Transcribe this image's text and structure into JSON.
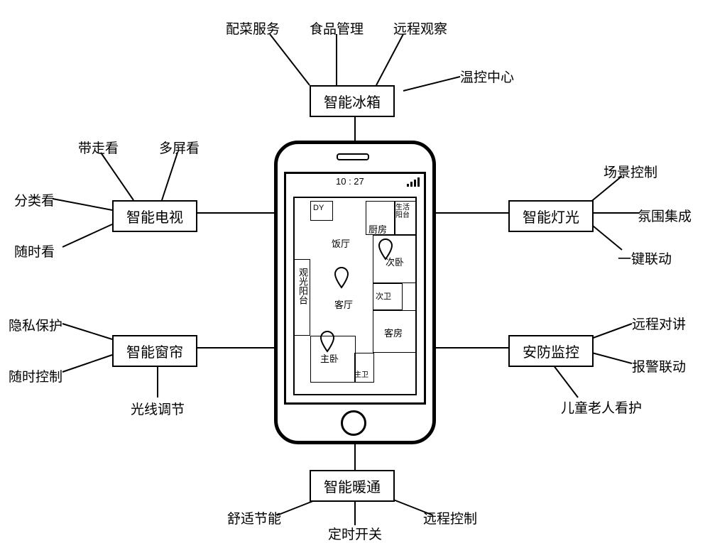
{
  "phone": {
    "time": "10 : 27",
    "floorplan": {
      "room_dy": "DY",
      "room_balcony_view": "观光阳台",
      "room_dining": "饭厅",
      "room_kitchen": "厨房",
      "room_life_balcony": "生活阳台",
      "room_second_bedroom": "次卧",
      "room_living": "客厅",
      "room_secondary_bath": "次卫",
      "room_master_bedroom": "主卧",
      "room_master_bath": "主卫",
      "room_guest": "客房"
    }
  },
  "nodes": {
    "fridge": {
      "label": "智能冰箱",
      "children": [
        "配菜服务",
        "食品管理",
        "远程观察",
        "温控中心"
      ]
    },
    "tv": {
      "label": "智能电视",
      "children": [
        "带走看",
        "多屏看",
        "分类看",
        "随时看"
      ]
    },
    "curtain": {
      "label": "智能窗帘",
      "children": [
        "隐私保护",
        "随时控制",
        "光线调节"
      ]
    },
    "light": {
      "label": "智能灯光",
      "children": [
        "场景控制",
        "氛围集成",
        "一键联动"
      ]
    },
    "security": {
      "label": "安防监控",
      "children": [
        "远程对讲",
        "报警联动",
        "儿童老人看护"
      ]
    },
    "hvac": {
      "label": "智能暖通",
      "children": [
        "舒适节能",
        "定时开关",
        "远程控制"
      ]
    }
  }
}
